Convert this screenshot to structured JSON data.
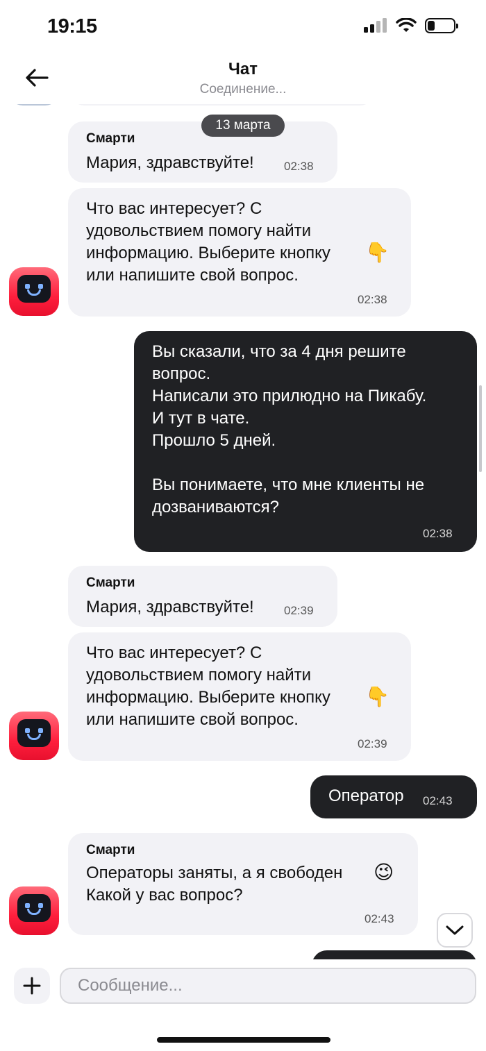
{
  "status": {
    "time": "19:15"
  },
  "header": {
    "title": "Чат",
    "subtitle": "Соединение..."
  },
  "date_chip": "13 марта",
  "messages": [
    {
      "from": "bot",
      "sender": "Смарти",
      "text": "Мария, здравствуйте!",
      "time": "02:38"
    },
    {
      "from": "bot",
      "text": "Что вас интересует? С\nудовольствием помогу найти\nинформацию. Выберите кнопку\nили напишите свой вопрос.",
      "emoji": "👇",
      "time": "02:38"
    },
    {
      "from": "user",
      "text": "Вы сказали, что за 4 дня решите\nвопрос.\nНаписали это прилюдно на Пикабу.\nИ тут в чате.\nПрошло 5 дней.\n\nВы понимаете, что мне клиенты не\nдозваниваются?",
      "time": "02:38"
    },
    {
      "from": "bot",
      "sender": "Смарти",
      "text": "Мария, здравствуйте!",
      "time": "02:39"
    },
    {
      "from": "bot",
      "text": "Что вас интересует? С\nудовольствием помогу найти\nинформацию. Выберите кнопку\nили напишите свой вопрос.",
      "emoji": "👇",
      "time": "02:39"
    },
    {
      "from": "user",
      "text": "Оператор",
      "time": "02:43"
    },
    {
      "from": "bot",
      "sender": "Смарти",
      "text": "Операторы заняты, а я свободен\nКакой у вас вопрос?",
      "emoji": "😉",
      "time": "02:43"
    }
  ],
  "composer": {
    "placeholder": "Сообщение..."
  },
  "colors": {
    "incoming_bubble": "#f2f2f6",
    "outgoing_bubble": "#202124",
    "avatar_red": "#ff1f3d"
  },
  "icons": {
    "back": "arrow-left-icon",
    "scroll_down": "chevron-down-icon",
    "attach": "plus-icon"
  }
}
